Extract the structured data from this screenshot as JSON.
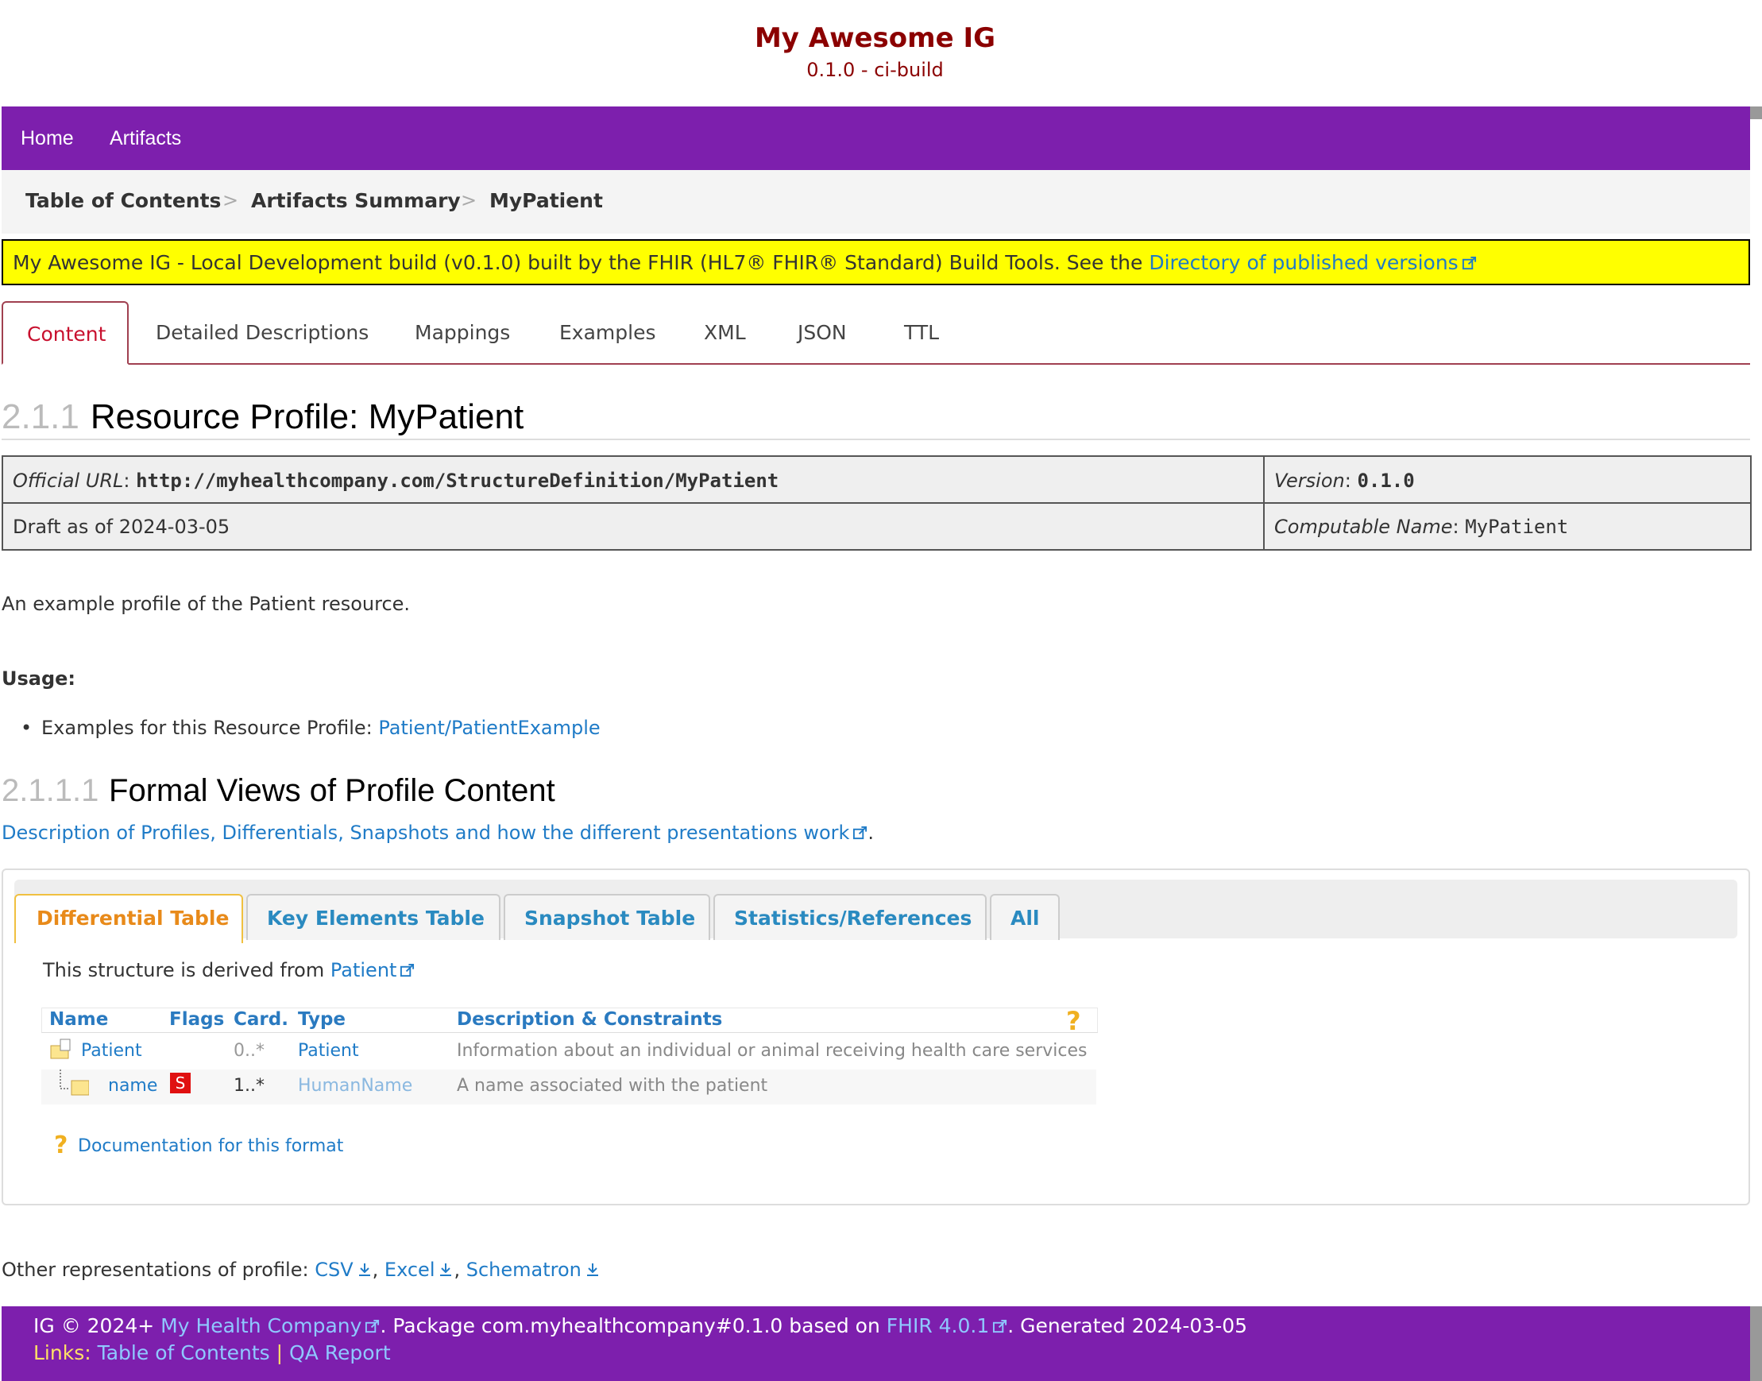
{
  "header": {
    "title": "My Awesome IG",
    "version": "0.1.0 - ci-build"
  },
  "nav": {
    "items": [
      "Home",
      "Artifacts"
    ]
  },
  "breadcrumb": {
    "items": [
      "Table of Contents",
      "Artifacts Summary",
      "MyPatient"
    ],
    "separator": ">"
  },
  "banner": {
    "text": "My Awesome IG - Local Development build (v0.1.0) built by the FHIR (HL7® FHIR® Standard) Build Tools. See the ",
    "link": "Directory of published versions",
    "bg_color": "#ffff00"
  },
  "tabs": [
    "Content",
    "Detailed Descriptions",
    "Mappings",
    "Examples",
    "XML",
    "JSON",
    "TTL"
  ],
  "profile_heading": {
    "number": "2.1.1",
    "title": "Resource Profile: MyPatient"
  },
  "meta": {
    "official_url_label": "Official URL",
    "official_url": "http://myhealthcompany.com/StructureDefinition/MyPatient",
    "version_label": "Version",
    "version": "0.1.0",
    "status": "Draft as of 2024-03-05",
    "computable_name_label": "Computable Name",
    "computable_name": "MyPatient"
  },
  "description": "An example profile of the Patient resource.",
  "usage": {
    "heading": "Usage:",
    "item_text": "Examples for this Resource Profile: ",
    "item_link": "Patient/PatientExample"
  },
  "formal_views": {
    "number": "2.1.1.1",
    "title": "Formal Views of Profile Content",
    "desc_link": "Description of Profiles, Differentials, Snapshots and how the different presentations work",
    "desc_suffix": ".",
    "tabs": [
      "Differential Table",
      "Key Elements Table",
      "Snapshot Table",
      "Statistics/References",
      "All"
    ],
    "derived_text": "This structure is derived from ",
    "derived_link": "Patient",
    "table": {
      "headers": [
        "Name",
        "Flags",
        "Card.",
        "Type",
        "Description & Constraints"
      ],
      "rows": [
        {
          "name": "Patient",
          "flags": "",
          "card": "0..*",
          "type": "Patient",
          "desc": "Information about an individual or animal receiving health care services"
        },
        {
          "name": "name",
          "flags": "S",
          "card": "1..*",
          "type": "HumanName",
          "desc": "A name associated with the patient"
        }
      ]
    },
    "doc_link": "Documentation for this format"
  },
  "other_reps": {
    "text": "Other representations of profile: ",
    "links": [
      "CSV",
      "Excel",
      "Schematron"
    ]
  },
  "footer": {
    "line1_pre": "IG © 2024+ ",
    "company": "My Health Company",
    "line1_mid": ". Package com.myhealthcompany#0.1.0 based on ",
    "fhir": "FHIR 4.0.1",
    "line1_post": ". Generated 2024-03-05",
    "links_label": "Links: ",
    "links": [
      "Table of Contents",
      "QA Report"
    ],
    "links_sep": "|"
  },
  "colors": {
    "nav": "#7d1fad",
    "title": "#8b0000",
    "link": "#1f7bc7",
    "active_tab": "#c8102e",
    "fv_active": "#e88a1a"
  }
}
